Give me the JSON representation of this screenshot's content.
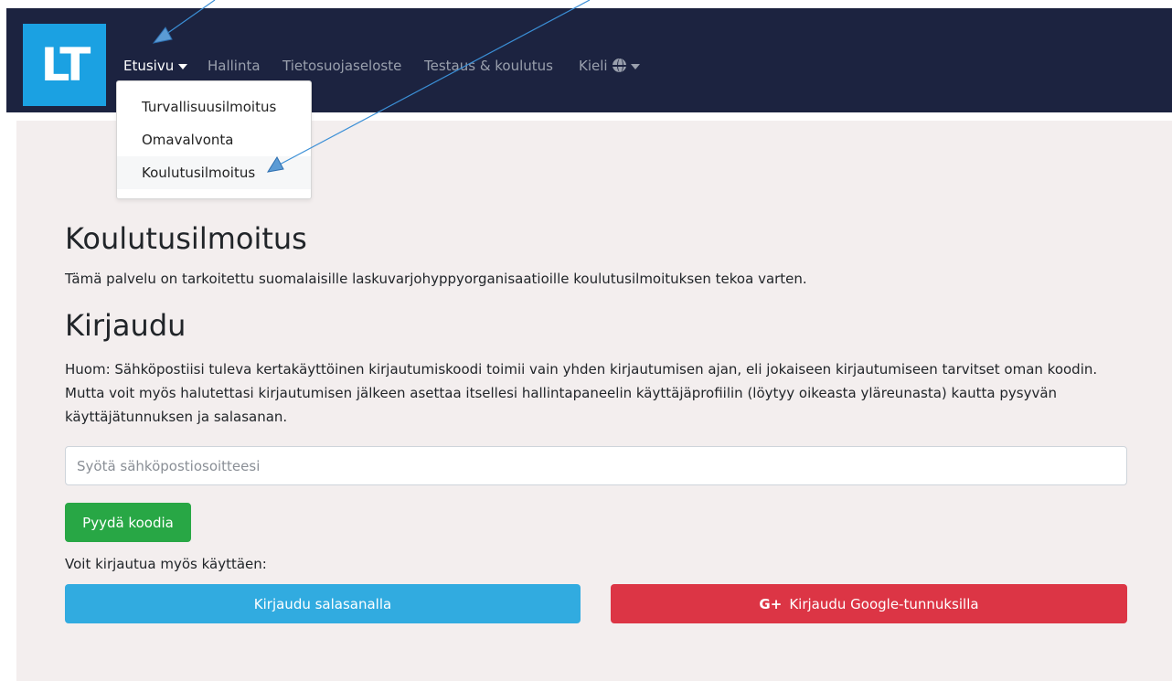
{
  "navbar": {
    "logo": "LT",
    "items": [
      {
        "label": "Etusivu"
      },
      {
        "label": "Hallinta"
      },
      {
        "label": "Tietosuojaseloste"
      },
      {
        "label": "Testaus & koulutus"
      },
      {
        "label": "Kieli"
      }
    ]
  },
  "dropdown": {
    "items": [
      {
        "label": "Turvallisuusilmoitus"
      },
      {
        "label": "Omavalvonta"
      },
      {
        "label": "Koulutusilmoitus"
      }
    ]
  },
  "main": {
    "title": "Koulutusilmoitus",
    "intro": "Tämä palvelu on tarkoitettu suomalaisille laskuvarjohyppyorganisaatioille koulutusilmoituksen tekoa varten.",
    "login_title": "Kirjaudu",
    "note": "Huom: Sähköpostiisi tuleva kertakäyttöinen kirjautumiskoodi toimii vain yhden kirjautumisen ajan, eli jokaiseen kirjautumiseen tarvitset oman koodin. Mutta voit myös halutettasi kirjautumisen jälkeen asettaa itsellesi hallintapaneelin käyttäjäprofiilin (löytyy oikeasta yläreunasta) kautta pysyvän käyttäjätunnuksen ja salasanan.",
    "email_placeholder": "Syötä sähköpostiosoitteesi",
    "request_code": "Pyydä koodia",
    "alt_login": "Voit kirjautua myös käyttäen:",
    "password_login": "Kirjaudu salasanalla",
    "google_icon": "G+",
    "google_login": "Kirjaudu Google-tunnuksilla"
  },
  "colors": {
    "navbar": "#1c2340",
    "logo": "#1ba1e2",
    "panel": "#f3eeee",
    "success": "#28a745",
    "info": "#31abe0",
    "danger": "#dc3545",
    "annotation": "#3b8fd6"
  },
  "icons": [
    "caret-down-icon",
    "globe-icon",
    "google-plus-icon"
  ]
}
